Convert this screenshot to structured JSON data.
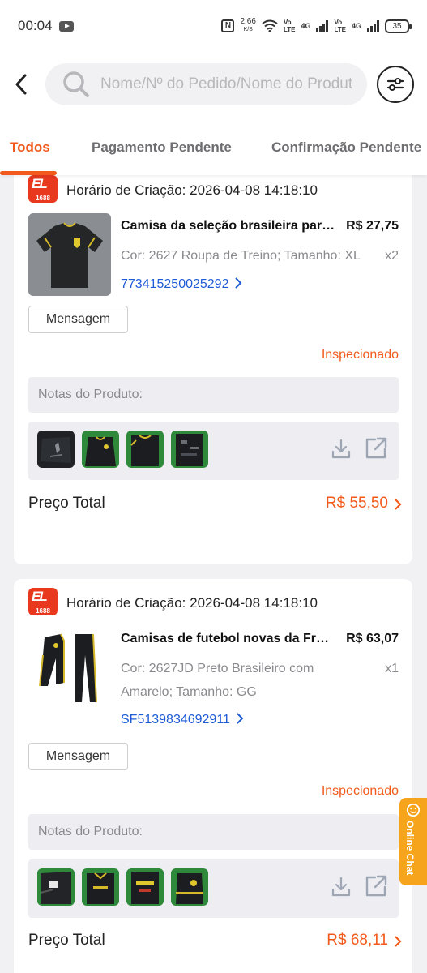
{
  "status_bar": {
    "time": "00:04",
    "speed_value": "2,66",
    "speed_unit": "K/S",
    "volte_1": [
      "Vo",
      "LTE"
    ],
    "net_1": "4G",
    "volte_2": [
      "Vo",
      "LTE"
    ],
    "net_2": "4G",
    "battery": "35"
  },
  "header": {
    "search_placeholder": "Nome/Nº do Pedido/Nome do Produto"
  },
  "tabs": [
    {
      "label": "Todos",
      "active": true
    },
    {
      "label": "Pagamento Pendente",
      "active": false
    },
    {
      "label": "Confirmação Pendente",
      "active": false
    }
  ],
  "orders": [
    {
      "created": "Horário de Criação: 2026-04-08 14:18:10",
      "product_name": "Camisa da seleção brasileira para treino",
      "price": "R$ 27,75",
      "variant_line1": "Cor: 2627 Roupa de Treino; Tamanho: XL",
      "variant_line2": "",
      "quantity": "x2",
      "tracking": "773415250025292",
      "message_button": "Mensagem",
      "status": "Inspecionado",
      "notes_label": "Notas do Produto:",
      "total_label": "Preço Total",
      "total_value": "R$ 55,50"
    },
    {
      "created": "Horário de Criação: 2026-04-08 14:18:10",
      "product_name": "Camisas de futebol novas da França",
      "price": "R$ 63,07",
      "variant_line1": "Cor: 2627JD Preto Brasileiro com",
      "variant_line2": "Amarelo; Tamanho: GG",
      "quantity": "x1",
      "tracking": "SF5139834692911",
      "message_button": "Mensagem",
      "status": "Inspecionado",
      "notes_label": "Notas do Produto:",
      "total_label": "Preço Total",
      "total_value": "R$ 68,11"
    }
  ],
  "logo": {
    "mark": "EL",
    "number": "1688"
  },
  "chat": {
    "label": "Online Chat"
  },
  "colors": {
    "accent": "#f25a1b",
    "link": "#1e5bd6",
    "logo": "#e8391f",
    "chat": "#f7a41d"
  }
}
